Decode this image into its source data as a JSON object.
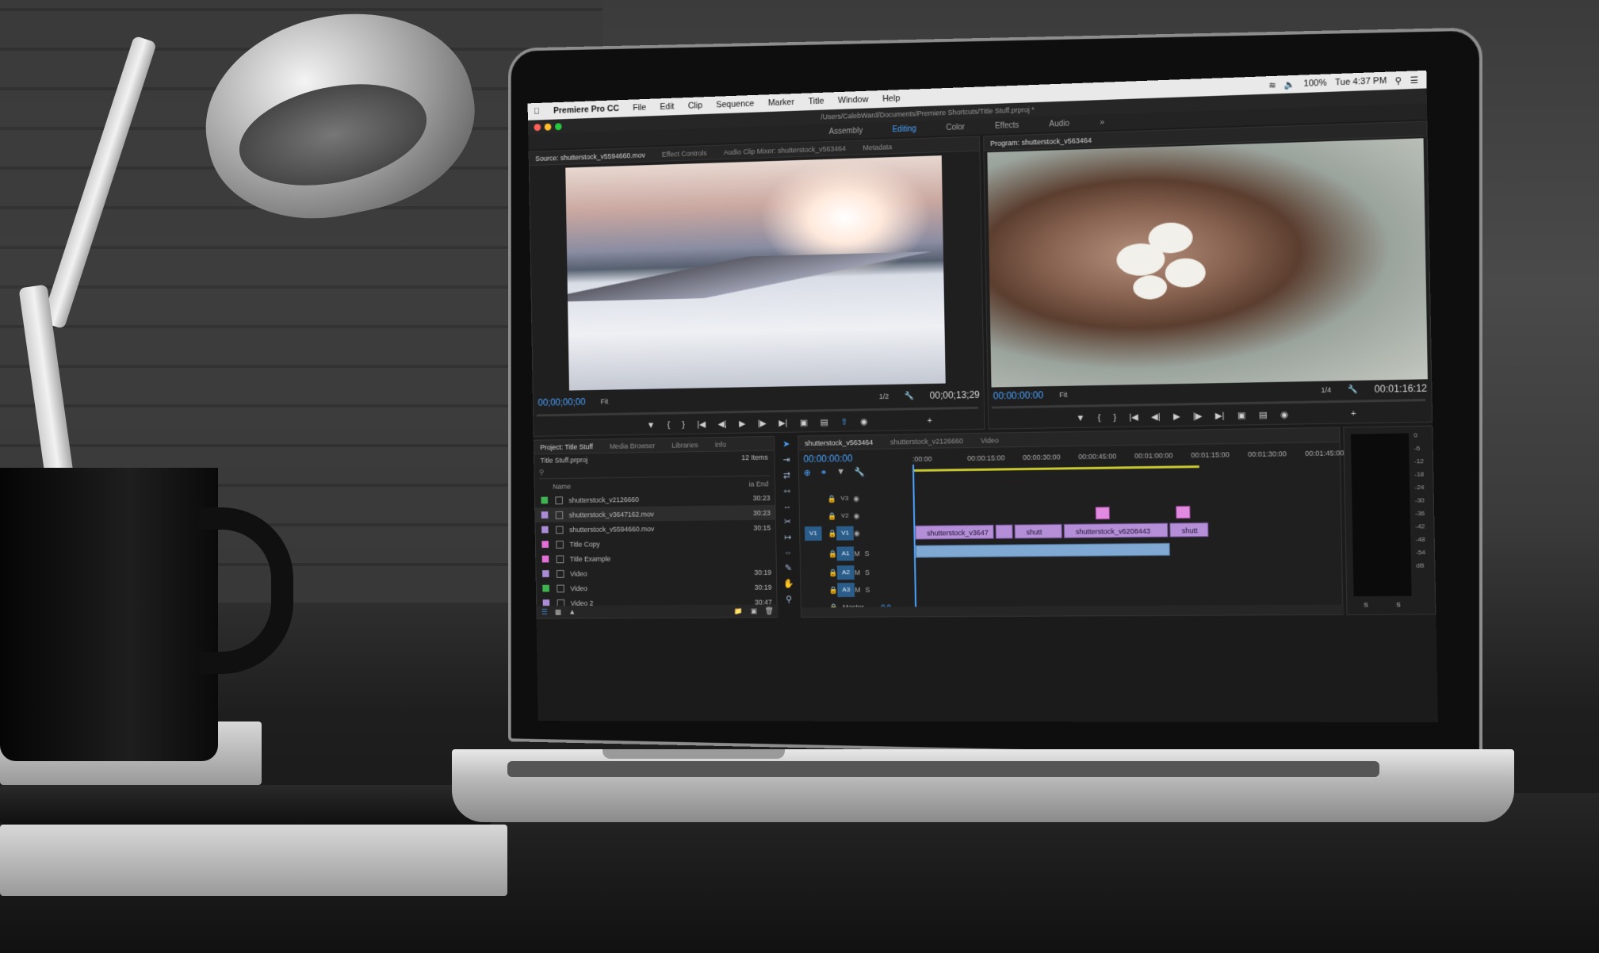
{
  "os_menubar": {
    "apple_icon": "apple-icon",
    "app_name": "Premiere Pro CC",
    "menus": [
      "File",
      "Edit",
      "Clip",
      "Sequence",
      "Marker",
      "Title",
      "Window",
      "Help"
    ],
    "battery": "100%",
    "clock": "Tue 4:37 PM"
  },
  "window": {
    "path": "/Users/CalebWard/Documents/Premiere Shortcuts/Title Stuff.prproj *"
  },
  "workspaces": {
    "items": [
      "Assembly",
      "Editing",
      "Color",
      "Effects",
      "Audio"
    ],
    "active": "Editing",
    "overflow": "»"
  },
  "source_panel": {
    "tabs": [
      "Source: shutterstock_v5594660.mov",
      "Effect Controls",
      "Audio Clip Mixer: shutterstock_v563464",
      "Metadata"
    ],
    "timecode": "00;00;00;00",
    "fit": "Fit",
    "resolution": "1/2",
    "duration": "00;00;13;29"
  },
  "program_panel": {
    "tab": "Program: shutterstock_v563464",
    "timecode": "00:00:00:00",
    "fit": "Fit",
    "resolution": "1/4",
    "duration": "00:01:16:12"
  },
  "project_panel": {
    "tabs": [
      "Project: Title Stuff",
      "Media Browser",
      "Libraries",
      "Info"
    ],
    "file": "Title Stuff.prproj",
    "item_count": "12 Items",
    "col_name": "Name",
    "col_end": "ia End",
    "items": [
      {
        "name": "shutterstock_v2126660",
        "dur": "30:23",
        "color": "#3fb34f"
      },
      {
        "name": "shutterstock_v3647162.mov",
        "dur": "30:23",
        "color": "#a98bd6"
      },
      {
        "name": "shutterstock_v5594660.mov",
        "dur": "30:15",
        "color": "#a98bd6"
      },
      {
        "name": "Title Copy",
        "dur": "",
        "color": "#e26fd5"
      },
      {
        "name": "Title Example",
        "dur": "",
        "color": "#e26fd5"
      },
      {
        "name": "Video",
        "dur": "30:19",
        "color": "#a98bd6"
      },
      {
        "name": "Video",
        "dur": "30:19",
        "color": "#3fb34f"
      },
      {
        "name": "Video 2",
        "dur": "30:47",
        "color": "#a98bd6"
      }
    ]
  },
  "timeline": {
    "tabs": [
      "shutterstock_v563464",
      "shutterstock_v2126660",
      "Video"
    ],
    "timecode": "00:00:00:00",
    "ruler": [
      ":00:00",
      "00:00:15:00",
      "00:00:30:00",
      "00:00:45:00",
      "00:01:00:00",
      "00:01:15:00",
      "00:01:30:00",
      "00:01:45:00"
    ],
    "tracks": [
      "V3",
      "V2",
      "V1",
      "A1",
      "A2",
      "A3"
    ],
    "master_label": "Master",
    "master_value": "0.0",
    "clips": [
      "shutterstock_v3647",
      "shutt",
      "shutterstock_v6208443",
      "shutt"
    ]
  },
  "audio_meter": {
    "scale": [
      "0",
      "-6",
      "-12",
      "-18",
      "-24",
      "-30",
      "-36",
      "-42",
      "-48",
      "-54",
      "dB"
    ],
    "bottom": [
      "S",
      "S"
    ]
  }
}
